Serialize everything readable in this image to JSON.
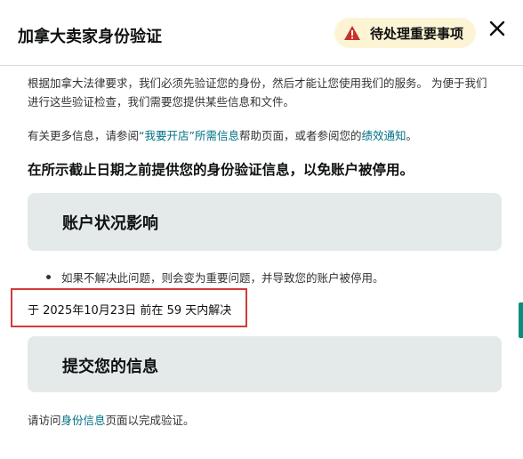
{
  "header": {
    "title": "加拿大卖家身份验证",
    "alert_label": "待处理重要事项"
  },
  "intro": {
    "text": "根据加拿大法律要求，我们必须先验证您的身份，然后才能让您使用我们的服务。 为便于我们进行这些验证检查，我们需要您提供某些信息和文件。"
  },
  "more_info": {
    "prefix": "有关更多信息，请参阅",
    "link1": "“我要开店”所需信息",
    "middle": "帮助页面，或者参阅您的",
    "link2": "绩效通知",
    "suffix": "。"
  },
  "deadline": "在所示截止日期之前提供您的身份验证信息，以免账户被停用。",
  "account_impact": {
    "title": "账户状况影响",
    "bullet": "如果不解决此问题，则会变为重要问题，并导致您的账户被停用。"
  },
  "resolve_by": "于 2025年10月23日 前在 59 天内解决",
  "submit": {
    "title": "提交您的信息"
  },
  "visit": {
    "prefix": "请访问",
    "link": "身份信息",
    "suffix": "页面以完成验证。"
  },
  "colors": {
    "accent_link": "#007185",
    "alert_bg": "#fcf4d4",
    "warning_red": "#c7302b",
    "card_bg": "#e4eaea",
    "highlight_border": "#d33a3a"
  },
  "icons": {
    "warning": "warning-triangle-icon",
    "close": "close-icon"
  }
}
